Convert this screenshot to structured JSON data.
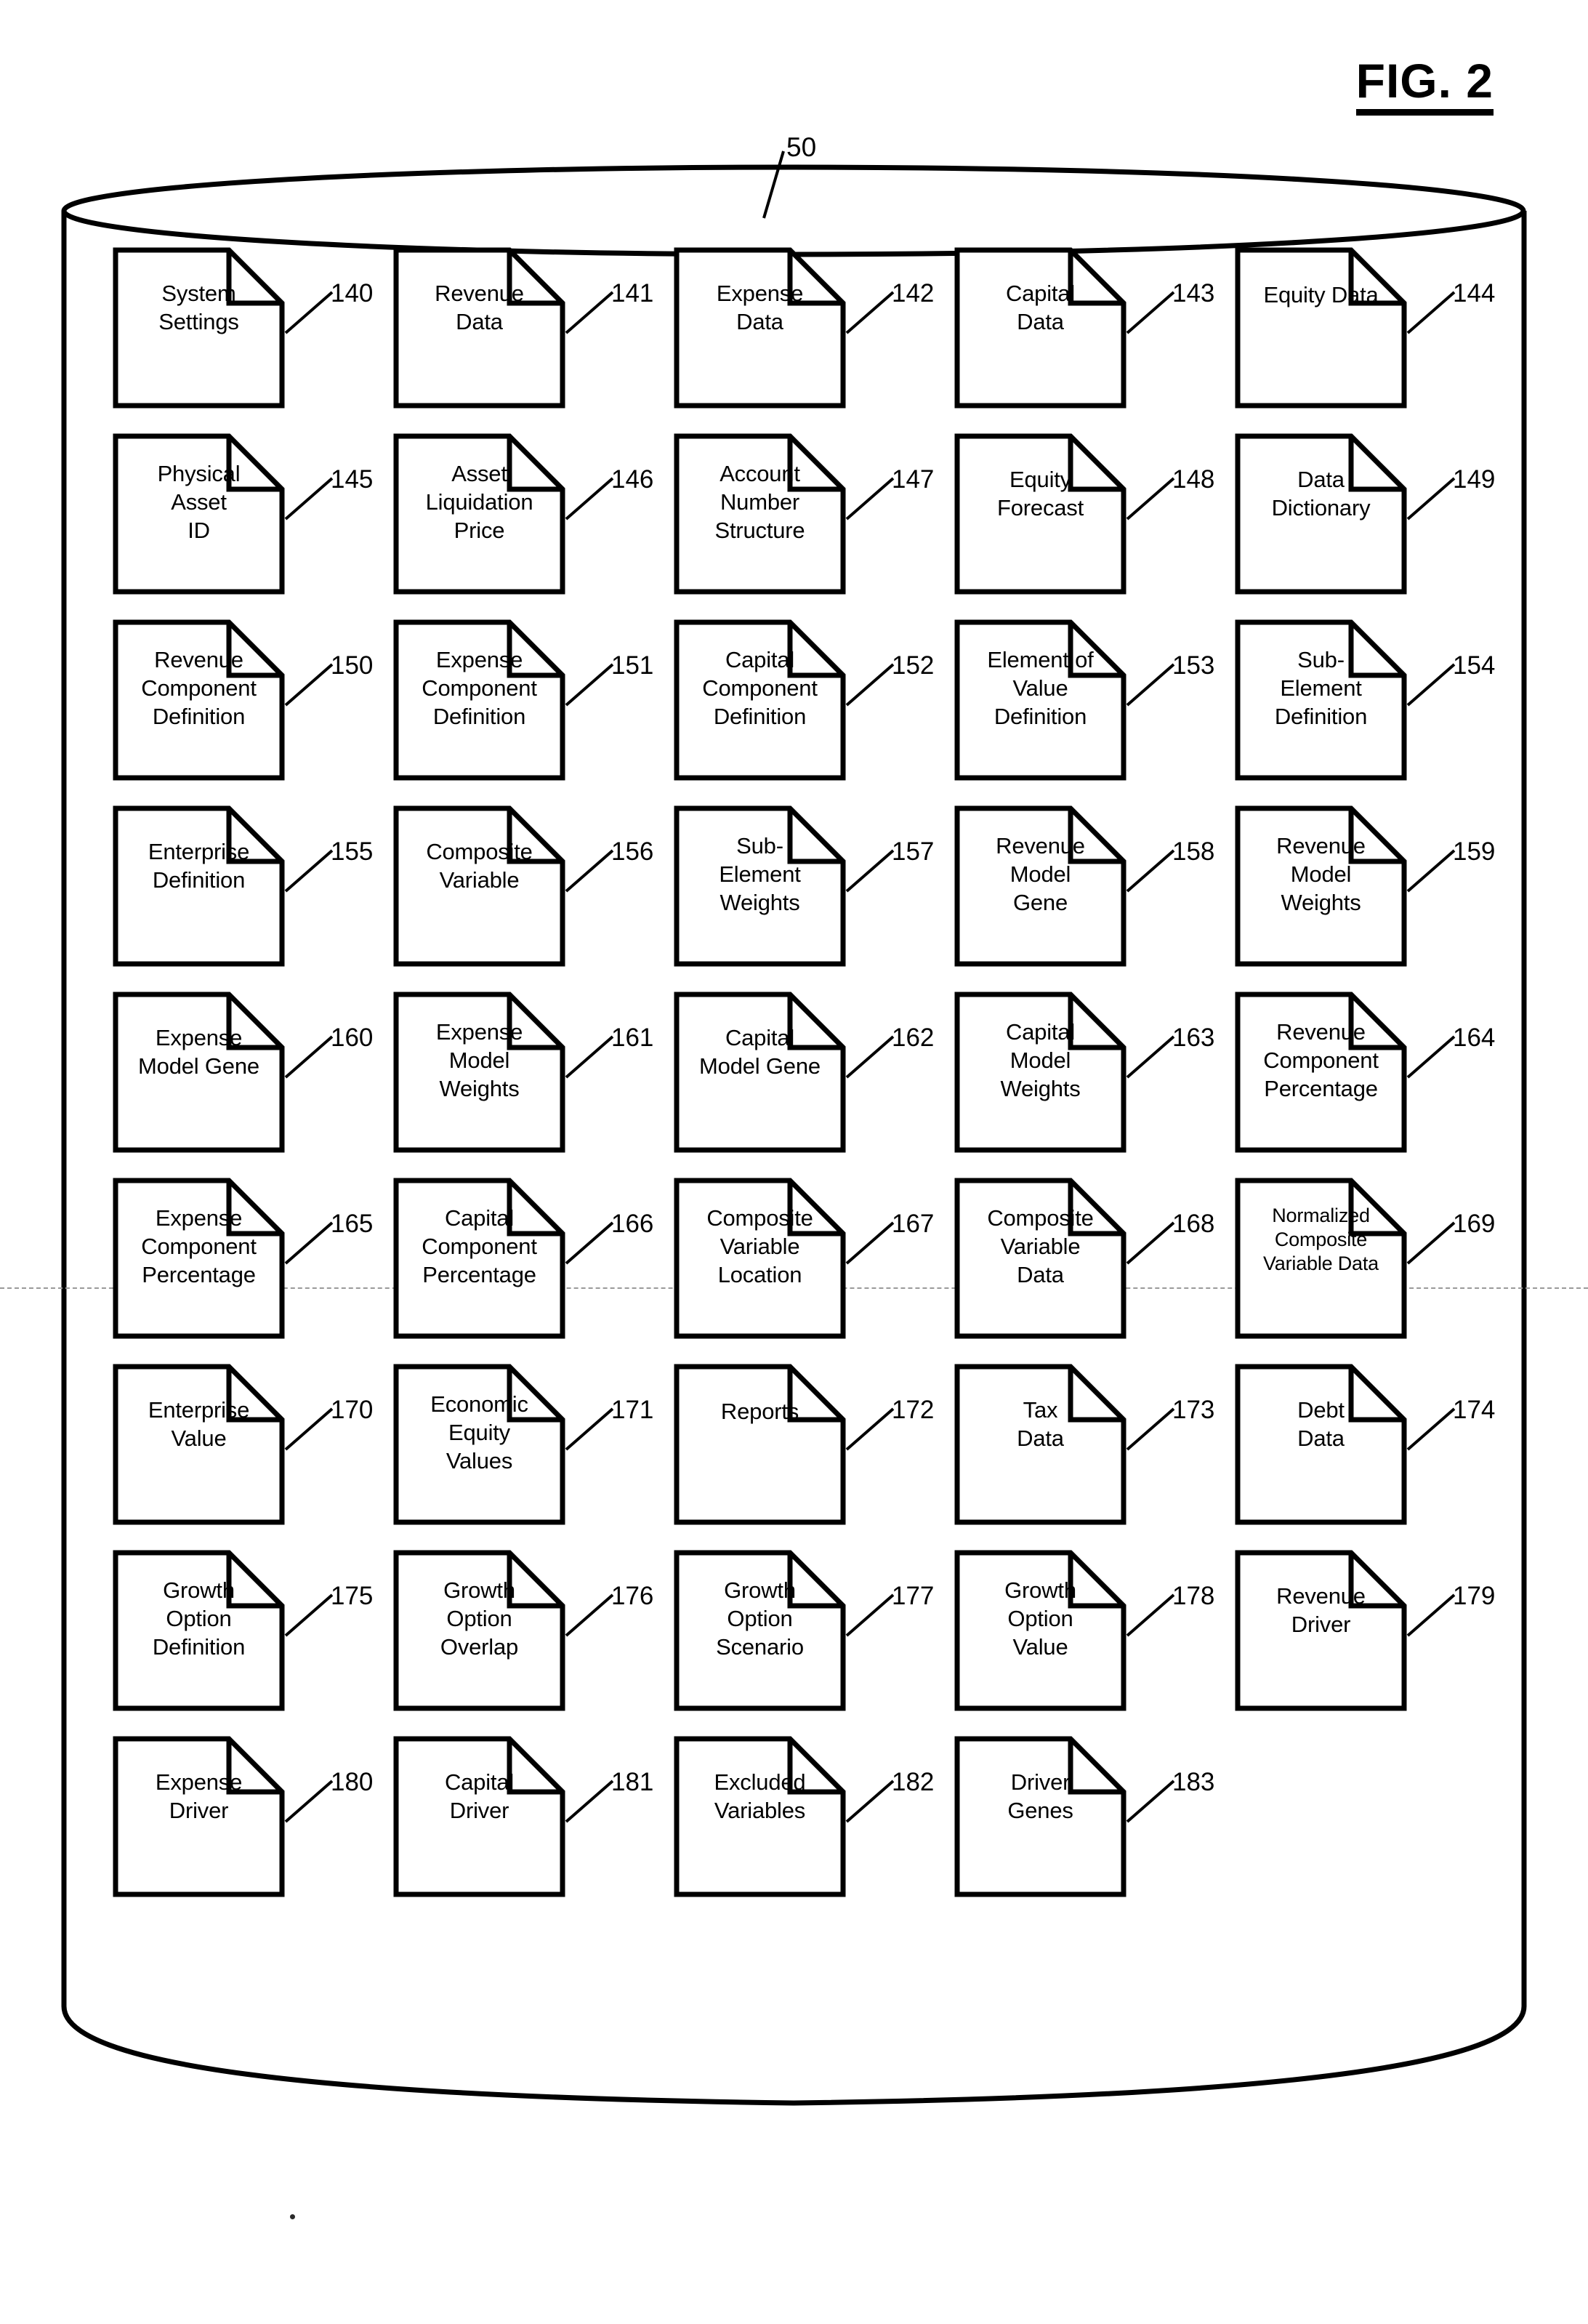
{
  "figure": {
    "title": "FIG. 2",
    "callout_label": "50",
    "container_shape": "database-cylinder"
  },
  "grid": {
    "columns": 5,
    "rows": 10,
    "items": [
      {
        "ref": "140",
        "lines": [
          "System",
          "Settings"
        ]
      },
      {
        "ref": "141",
        "lines": [
          "Revenue",
          "Data"
        ]
      },
      {
        "ref": "142",
        "lines": [
          "Expense",
          "Data"
        ]
      },
      {
        "ref": "143",
        "lines": [
          "Capital",
          "Data"
        ]
      },
      {
        "ref": "144",
        "lines": [
          "Equity Data"
        ]
      },
      {
        "ref": "145",
        "lines": [
          "Physical",
          "Asset",
          "ID"
        ]
      },
      {
        "ref": "146",
        "lines": [
          "Asset",
          "Liquidation",
          "Price"
        ]
      },
      {
        "ref": "147",
        "lines": [
          "Account",
          "Number",
          "Structure"
        ]
      },
      {
        "ref": "148",
        "lines": [
          "Equity",
          "Forecast"
        ]
      },
      {
        "ref": "149",
        "lines": [
          "Data",
          "Dictionary"
        ]
      },
      {
        "ref": "150",
        "lines": [
          "Revenue",
          "Component",
          "Definition"
        ]
      },
      {
        "ref": "151",
        "lines": [
          "Expense",
          "Component",
          "Definition"
        ]
      },
      {
        "ref": "152",
        "lines": [
          "Capital",
          "Component",
          "Definition"
        ]
      },
      {
        "ref": "153",
        "lines": [
          "Element of",
          "Value",
          "Definition"
        ]
      },
      {
        "ref": "154",
        "lines": [
          "Sub-",
          "Element",
          "Definition"
        ]
      },
      {
        "ref": "155",
        "lines": [
          "Enterprise",
          "Definition"
        ]
      },
      {
        "ref": "156",
        "lines": [
          "Composite",
          "Variable"
        ]
      },
      {
        "ref": "157",
        "lines": [
          "Sub-",
          "Element",
          "Weights"
        ]
      },
      {
        "ref": "158",
        "lines": [
          "Revenue",
          "Model",
          "Gene"
        ]
      },
      {
        "ref": "159",
        "lines": [
          "Revenue",
          "Model",
          "Weights"
        ]
      },
      {
        "ref": "160",
        "lines": [
          "Expense",
          "Model Gene"
        ]
      },
      {
        "ref": "161",
        "lines": [
          "Expense",
          "Model",
          "Weights"
        ]
      },
      {
        "ref": "162",
        "lines": [
          "Capital",
          "Model Gene"
        ]
      },
      {
        "ref": "163",
        "lines": [
          "Capital",
          "Model",
          "Weights"
        ]
      },
      {
        "ref": "164",
        "lines": [
          "Revenue",
          "Component",
          "Percentage"
        ]
      },
      {
        "ref": "165",
        "lines": [
          "Expense",
          "Component",
          "Percentage"
        ]
      },
      {
        "ref": "166",
        "lines": [
          "Capital",
          "Component",
          "Percentage"
        ]
      },
      {
        "ref": "167",
        "lines": [
          "Composite",
          "Variable",
          "Location"
        ]
      },
      {
        "ref": "168",
        "lines": [
          "Composite",
          "Variable",
          "Data"
        ]
      },
      {
        "ref": "169",
        "lines": [
          "Normalized",
          "Composite",
          "Variable Data"
        ],
        "small": true
      },
      {
        "ref": "170",
        "lines": [
          "Enterprise",
          "Value"
        ]
      },
      {
        "ref": "171",
        "lines": [
          "Economic",
          "Equity",
          "Values"
        ]
      },
      {
        "ref": "172",
        "lines": [
          "Reports"
        ]
      },
      {
        "ref": "173",
        "lines": [
          "Tax",
          "Data"
        ]
      },
      {
        "ref": "174",
        "lines": [
          "Debt",
          "Data"
        ]
      },
      {
        "ref": "175",
        "lines": [
          "Growth",
          "Option",
          "Definition"
        ]
      },
      {
        "ref": "176",
        "lines": [
          "Growth",
          "Option",
          "Overlap"
        ]
      },
      {
        "ref": "177",
        "lines": [
          "Growth",
          "Option",
          "Scenario"
        ]
      },
      {
        "ref": "178",
        "lines": [
          "Growth",
          "Option",
          "Value"
        ]
      },
      {
        "ref": "179",
        "lines": [
          "Revenue",
          "Driver"
        ]
      },
      {
        "ref": "180",
        "lines": [
          "Expense",
          "Driver"
        ]
      },
      {
        "ref": "181",
        "lines": [
          "Capital",
          "Driver"
        ]
      },
      {
        "ref": "182",
        "lines": [
          "Excluded",
          "Variables"
        ]
      },
      {
        "ref": "183",
        "lines": [
          "Driver",
          "Genes"
        ]
      },
      null
    ]
  },
  "colors": {
    "ink": "#000000",
    "paper": "#ffffff",
    "fold_line": "#9a9a9a"
  }
}
